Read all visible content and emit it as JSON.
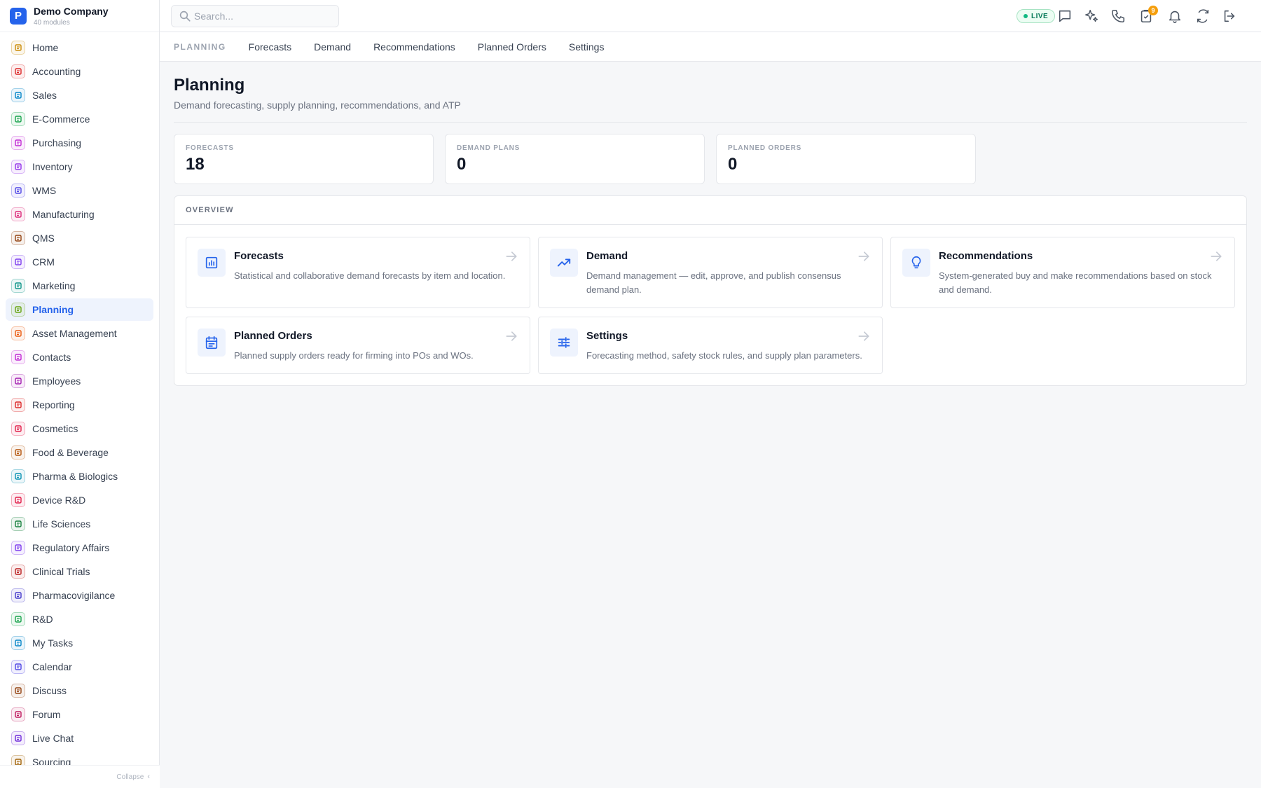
{
  "brand": {
    "logo_letter": "P",
    "name": "Demo Company",
    "subtitle": "40 modules"
  },
  "sidebar": {
    "items": [
      {
        "label": "Home",
        "icon": "grid-icon",
        "color": "#ca8a04"
      },
      {
        "label": "Accounting",
        "icon": "bank-icon",
        "color": "#dc2626"
      },
      {
        "label": "Sales",
        "icon": "badge-person-icon",
        "color": "#0284c7"
      },
      {
        "label": "E-Commerce",
        "icon": "storefront-icon",
        "color": "#16a34a"
      },
      {
        "label": "Purchasing",
        "icon": "cart-icon",
        "color": "#c026d3"
      },
      {
        "label": "Inventory",
        "icon": "archive-box-icon",
        "color": "#9333ea"
      },
      {
        "label": "WMS",
        "icon": "warehouse-icon",
        "color": "#4f46e5"
      },
      {
        "label": "Manufacturing",
        "icon": "factory-icon",
        "color": "#db2777"
      },
      {
        "label": "QMS",
        "icon": "check-badge-icon",
        "color": "#92400e"
      },
      {
        "label": "CRM",
        "icon": "people-icon",
        "color": "#7c3aed"
      },
      {
        "label": "Marketing",
        "icon": "megaphone-icon",
        "color": "#0d9488"
      },
      {
        "label": "Planning",
        "icon": "calendar-grid-icon",
        "color": "#65a30d",
        "active": true
      },
      {
        "label": "Asset Management",
        "icon": "tools-icon",
        "color": "#ea580c"
      },
      {
        "label": "Contacts",
        "icon": "contact-card-icon",
        "color": "#c026d3"
      },
      {
        "label": "Employees",
        "icon": "id-badge-icon",
        "color": "#a21caf"
      },
      {
        "label": "Reporting",
        "icon": "bar-chart-icon",
        "color": "#dc2626"
      },
      {
        "label": "Cosmetics",
        "icon": "lotus-icon",
        "color": "#e11d48"
      },
      {
        "label": "Food & Beverage",
        "icon": "utensils-icon",
        "color": "#b45309"
      },
      {
        "label": "Pharma & Biologics",
        "icon": "pill-bottle-icon",
        "color": "#0891b2"
      },
      {
        "label": "Device R&D",
        "icon": "gear-chip-icon",
        "color": "#e11d48"
      },
      {
        "label": "Life Sciences",
        "icon": "microscope-icon",
        "color": "#15803d"
      },
      {
        "label": "Regulatory Affairs",
        "icon": "gavel-icon",
        "color": "#7c3aed"
      },
      {
        "label": "Clinical Trials",
        "icon": "clipboard-icon",
        "color": "#b91c1c"
      },
      {
        "label": "Pharmacovigilance",
        "icon": "shield-icon",
        "color": "#4338ca"
      },
      {
        "label": "R&D",
        "icon": "flask-icon",
        "color": "#16a34a"
      },
      {
        "label": "My Tasks",
        "icon": "checklist-icon",
        "color": "#0284c7"
      },
      {
        "label": "Calendar",
        "icon": "calendar-icon",
        "color": "#4f46e5"
      },
      {
        "label": "Discuss",
        "icon": "chat-bubbles-icon",
        "color": "#92400e"
      },
      {
        "label": "Forum",
        "icon": "forum-icon",
        "color": "#be185d"
      },
      {
        "label": "Live Chat",
        "icon": "headset-icon",
        "color": "#6d28d9"
      },
      {
        "label": "Sourcing",
        "icon": "sourcing-icon",
        "color": "#a16207"
      }
    ],
    "collapse_label": "Collapse"
  },
  "search": {
    "placeholder": "Search..."
  },
  "topbar": {
    "live_label": "LIVE",
    "notification_count": "9"
  },
  "subnav": {
    "section": "PLANNING",
    "tabs": [
      "Forecasts",
      "Demand",
      "Recommendations",
      "Planned Orders",
      "Settings"
    ]
  },
  "page": {
    "title": "Planning",
    "subtitle": "Demand forecasting, supply planning, recommendations, and ATP"
  },
  "stats": [
    {
      "label": "FORECASTS",
      "value": "18"
    },
    {
      "label": "DEMAND PLANS",
      "value": "0"
    },
    {
      "label": "PLANNED ORDERS",
      "value": "0"
    }
  ],
  "overview": {
    "heading": "OVERVIEW",
    "cards": [
      {
        "title": "Forecasts",
        "description": "Statistical and collaborative demand forecasts by item and location.",
        "icon": "chart-square-icon"
      },
      {
        "title": "Demand",
        "description": "Demand management — edit, approve, and publish consensus demand plan.",
        "icon": "trending-up-icon"
      },
      {
        "title": "Recommendations",
        "description": "System-generated buy and make recommendations based on stock and demand.",
        "icon": "lightbulb-icon"
      },
      {
        "title": "Planned Orders",
        "description": "Planned supply orders ready for firming into POs and WOs.",
        "icon": "calendar-list-icon"
      },
      {
        "title": "Settings",
        "description": "Forecasting method, safety stock rules, and supply plan parameters.",
        "icon": "sliders-icon"
      }
    ]
  },
  "colors": {
    "accent": "#2563eb",
    "live_green": "#10b981",
    "badge": "#f59e0b"
  }
}
